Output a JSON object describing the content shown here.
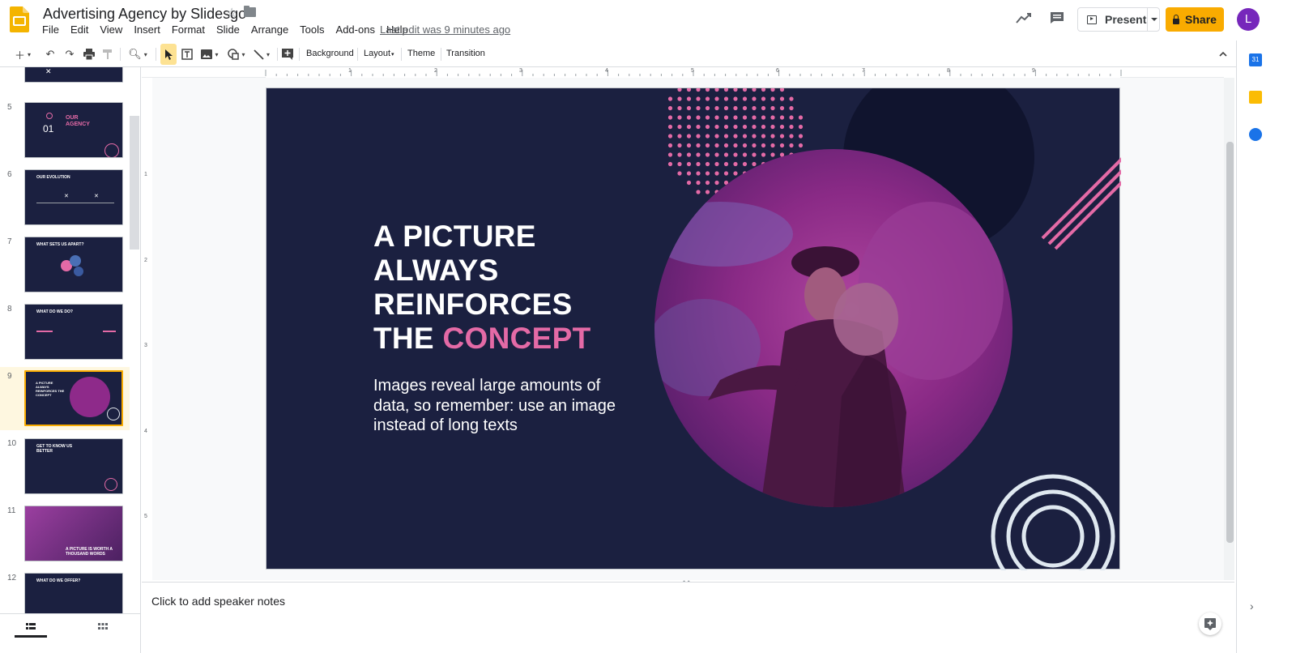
{
  "header": {
    "doc_title": "Advertising Agency by Slidesgo",
    "menus": [
      "File",
      "Edit",
      "View",
      "Insert",
      "Format",
      "Slide",
      "Arrange",
      "Tools",
      "Add-ons",
      "Help"
    ],
    "last_edit": "Last edit was 9 minutes ago",
    "present_label": "Present",
    "share_label": "Share",
    "avatar_letter": "L"
  },
  "toolbar": {
    "background_label": "Background",
    "layout_label": "Layout",
    "theme_label": "Theme",
    "transition_label": "Transition"
  },
  "ruler": {
    "marks": [
      "1",
      "1",
      "2",
      "3",
      "4",
      "5",
      "6",
      "7",
      "8",
      "9"
    ],
    "left_marks": [
      "1",
      "2",
      "3",
      "4",
      "5"
    ]
  },
  "filmstrip": {
    "slides": [
      {
        "num": "5",
        "title": "OUR AGENCY",
        "extra": "01"
      },
      {
        "num": "6",
        "title": "OUR EVOLUTION",
        "extra": ""
      },
      {
        "num": "7",
        "title": "WHAT SETS US APART?",
        "extra": ""
      },
      {
        "num": "8",
        "title": "WHAT DO WE DO?",
        "extra": ""
      },
      {
        "num": "9",
        "title": "A PICTURE ALWAYS REINFORCES THE CONCEPT",
        "extra": ""
      },
      {
        "num": "10",
        "title": "GET TO KNOW US BETTER",
        "extra": ""
      },
      {
        "num": "11",
        "title": "A PICTURE IS WORTH A THOUSAND WORDS",
        "extra": ""
      },
      {
        "num": "12",
        "title": "WHAT DO WE OFFER?",
        "extra": ""
      }
    ]
  },
  "slide": {
    "title_line1": "A PICTURE",
    "title_line2": "ALWAYS",
    "title_line3": "REINFORCES",
    "title_line4_prefix": "THE ",
    "title_line4_accent": "CONCEPT",
    "body": "Images reveal large amounts of data, so remember: use an image instead of long texts"
  },
  "notes": {
    "placeholder": "Click to add speaker notes"
  },
  "colors": {
    "slide_bg": "#1b2040",
    "accent_pink": "#e46aa6",
    "share_yellow": "#f9ab00"
  }
}
